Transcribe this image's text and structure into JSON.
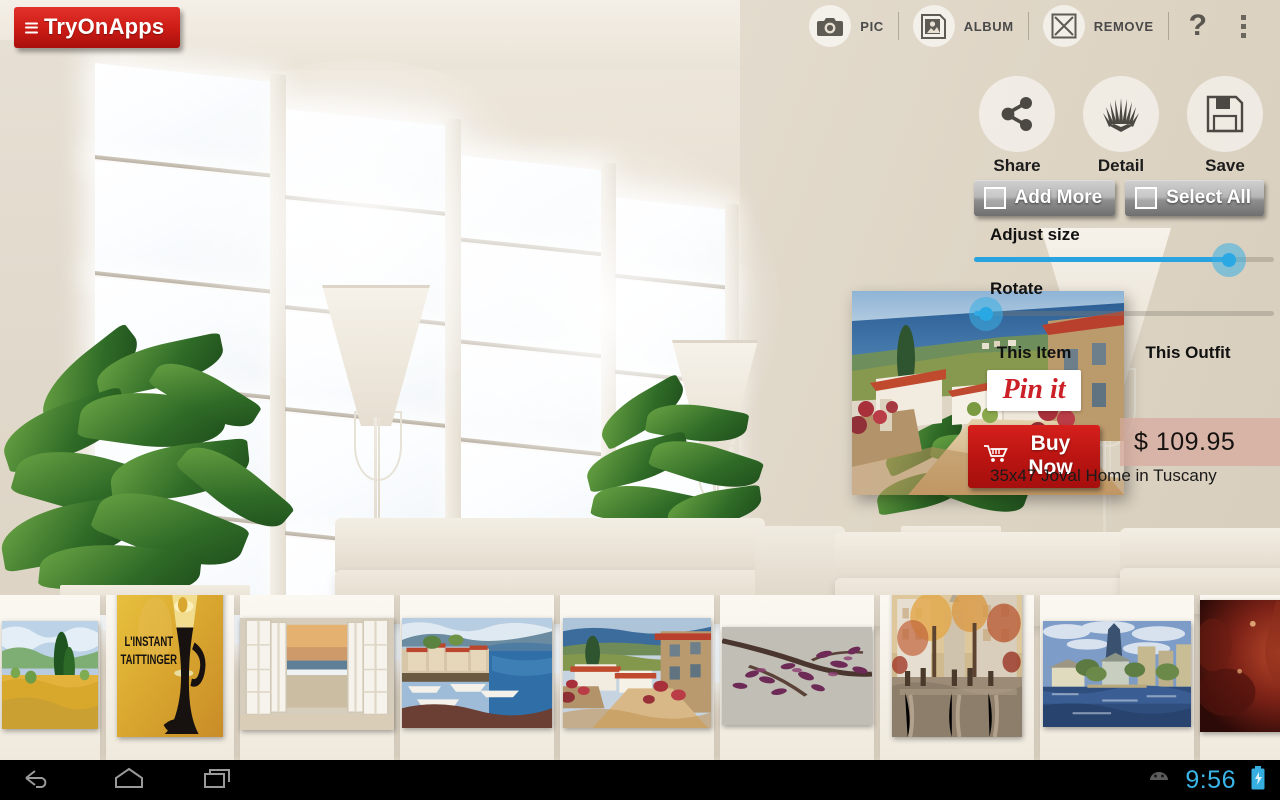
{
  "app": {
    "name": "TryOnApps",
    "menu_icon": "hamburger-icon"
  },
  "toolbar": {
    "items": [
      {
        "label": "PIC",
        "icon": "camera-icon"
      },
      {
        "label": "ALBUM",
        "icon": "album-picture-icon"
      },
      {
        "label": "REMOVE",
        "icon": "x-cross-icon"
      }
    ],
    "help_label": "?",
    "overflow_icon": "three-dot-menu-icon"
  },
  "actions": [
    {
      "label": "Share",
      "icon": "share-nodes-icon"
    },
    {
      "label": "Detail",
      "icon": "shell-fan-icon"
    },
    {
      "label": "Save",
      "icon": "floppy-disk-icon"
    }
  ],
  "checkbuttons": [
    {
      "label": "Add More",
      "checked": false
    },
    {
      "label": "Select All",
      "checked": false
    }
  ],
  "sliders": [
    {
      "label": "Adjust size",
      "value_pct": 85
    },
    {
      "label": "Rotate",
      "value_pct": 4
    }
  ],
  "product": {
    "this_item_label": "This Item",
    "this_outfit_label": "This Outfit",
    "pin_it_label": "Pin it",
    "buy_now_label": "Buy Now",
    "cart_icon": "shopping-cart-icon",
    "price": "$ 109.95",
    "name": "35x47 Joval Home in Tuscany"
  },
  "colors": {
    "brand_red": "#cf1d17",
    "buy_red": "#bb1512",
    "pinterest_red": "#cb2027",
    "slider_blue": "#29a3e0",
    "clock_blue": "#3ab5e8",
    "price_band": "#d6a99d",
    "toolbar_cream": "#e8e0d3"
  },
  "filmstrip": [
    {
      "name": "wheat-field-with-cypresses",
      "orientation": "landscape"
    },
    {
      "name": "l-instant-taittinger-poster",
      "orientation": "portrait",
      "caption_line1": "L'INSTANT",
      "caption_line2": "TAITTINGER"
    },
    {
      "name": "open-window-beach-sunset",
      "orientation": "landscape"
    },
    {
      "name": "harbor-boats-mediterranean",
      "orientation": "landscape"
    },
    {
      "name": "home-in-tuscany-village",
      "orientation": "landscape"
    },
    {
      "name": "purple-blossom-branch",
      "orientation": "landscape"
    },
    {
      "name": "paris-autumn-street",
      "orientation": "portrait"
    },
    {
      "name": "canal-church-impressionist",
      "orientation": "landscape"
    },
    {
      "name": "red-wine-glass-closeup",
      "orientation": "landscape"
    }
  ],
  "system": {
    "back_icon": "back-arrow-icon",
    "home_icon": "home-icon",
    "recents_icon": "recent-apps-icon",
    "android_icon": "android-robot-icon",
    "time": "9:56",
    "battery_icon": "battery-charging-icon"
  }
}
